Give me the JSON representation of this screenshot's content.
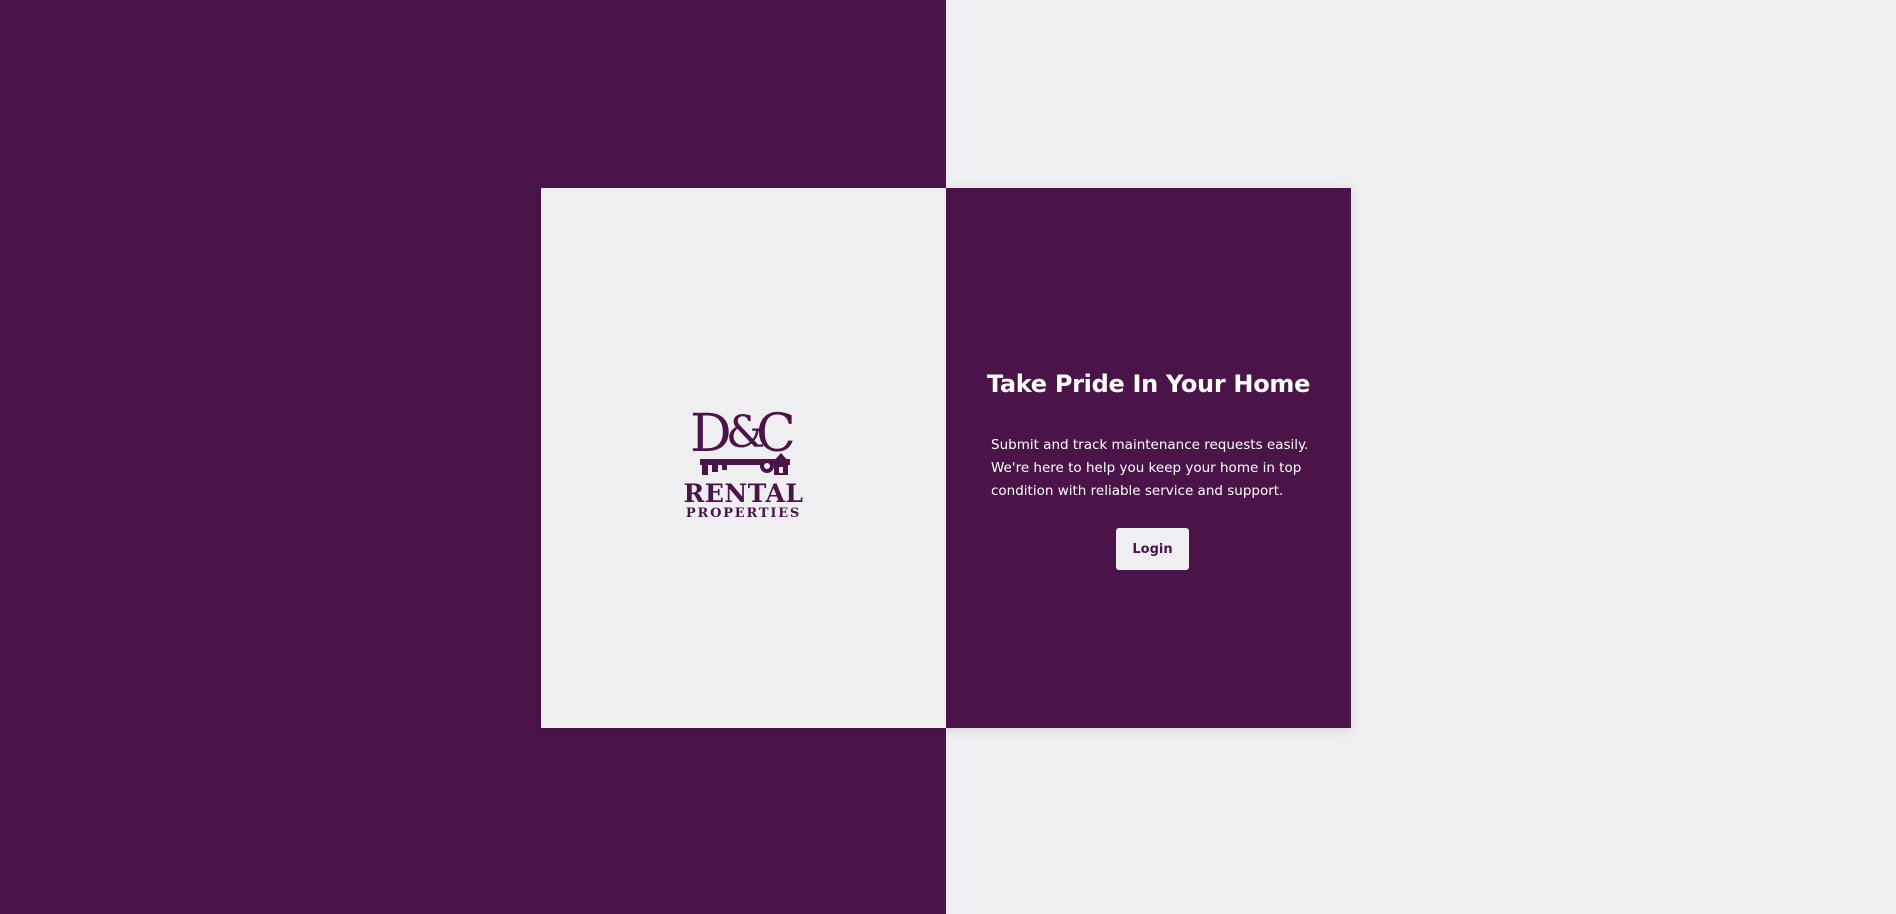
{
  "colors": {
    "brand_purple": "#4a1449",
    "light_gray": "#efeff1",
    "text_light": "#ffffff"
  },
  "logo": {
    "monogram": "D&C",
    "line1": "RENTAL",
    "line2": "PROPERTIES",
    "icon": "key-house-icon"
  },
  "hero": {
    "title": "Take Pride In Your Home",
    "description": "Submit and track maintenance requests easily. We're here to help you keep your home in top condition with reliable service and support.",
    "login_label": "Login"
  }
}
